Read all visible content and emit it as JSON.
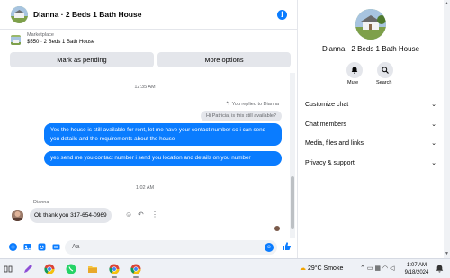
{
  "header": {
    "title": "Dianna · 2 Beds 1 Bath House",
    "info_icon": "i"
  },
  "marketplace": {
    "label": "Marketplace",
    "listing": "$550 · 2 Beds 1 Bath House",
    "pending_label": "Mark as pending",
    "more_label": "More options"
  },
  "messages": {
    "ts1": "12:35 AM",
    "replied": "You replied to Dianna",
    "quoted": "Hi Patricia, is this still available?",
    "out1": "Yes the house is still available for rent, let me have your contact number so i can send you details and the requirements about the house",
    "out2": "yes send me you contact number i send you location and details on you number",
    "ts2": "1:02 AM",
    "sender": "Dianna",
    "in1": "Ok thank you 317-654-0969"
  },
  "composer": {
    "placeholder": "Aa"
  },
  "side": {
    "name": "Dianna · 2 Beds 1 Bath House",
    "mute_label": "Mute",
    "search_label": "Search",
    "menu": [
      "Customize chat",
      "Chat members",
      "Media, files and links",
      "Privacy & support"
    ]
  },
  "taskbar": {
    "temp": "29°C",
    "weather": "Smoke",
    "time": "1:07 AM",
    "date": "9/18/2024"
  },
  "colors": {
    "accent": "#0a7cff",
    "bubble_in": "#e4e6eb",
    "muted_text": "#65676b"
  }
}
